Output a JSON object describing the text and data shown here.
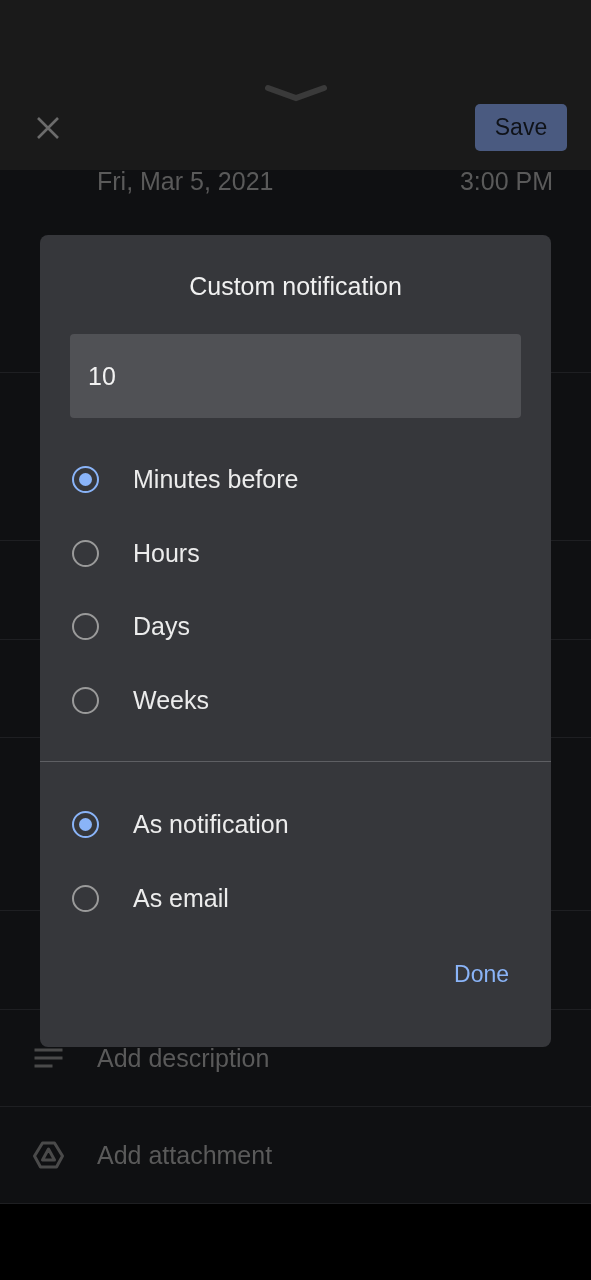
{
  "header": {
    "save_label": "Save"
  },
  "event": {
    "date": "Fri, Mar 5, 2021",
    "time": "3:00 PM"
  },
  "rows": [
    {
      "kind": "description",
      "placeholder": "Add description"
    },
    {
      "kind": "attachment",
      "placeholder": "Add attachment"
    }
  ],
  "dialog": {
    "title": "Custom notification",
    "value": "10",
    "units": [
      {
        "label": "Minutes before",
        "selected": true
      },
      {
        "label": "Hours",
        "selected": false
      },
      {
        "label": "Days",
        "selected": false
      },
      {
        "label": "Weeks",
        "selected": false
      }
    ],
    "delivery": [
      {
        "label": "As notification",
        "selected": true
      },
      {
        "label": "As email",
        "selected": false
      }
    ],
    "done_label": "Done"
  }
}
